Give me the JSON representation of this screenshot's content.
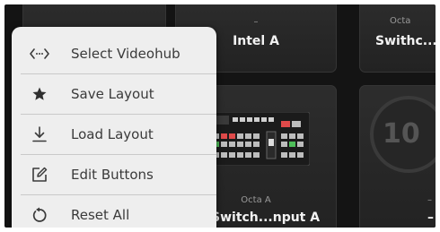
{
  "tiles": [
    {
      "id": "t1",
      "top": "",
      "main": ""
    },
    {
      "id": "t2",
      "top": "–",
      "main": "Intel A"
    },
    {
      "id": "t3",
      "top": "Octa",
      "main": "Swithc..."
    },
    {
      "id": "t4",
      "top": "Octa A",
      "main": "Switch...nput A"
    },
    {
      "id": "t5",
      "top": "–",
      "main": "–",
      "badge": "10"
    }
  ],
  "menu": {
    "items": [
      {
        "label": "Select Videohub",
        "icon": "code-arrows-icon"
      },
      {
        "label": "Save Layout",
        "icon": "star-icon"
      },
      {
        "label": "Load Layout",
        "icon": "download-icon"
      },
      {
        "label": "Edit Buttons",
        "icon": "edit-icon"
      },
      {
        "label": "Reset All",
        "icon": "reset-icon"
      }
    ]
  },
  "colors": {
    "background": "#141414",
    "tile": "#262626",
    "menu_bg": "#eeeeee",
    "menu_text": "#3a3a3a"
  }
}
